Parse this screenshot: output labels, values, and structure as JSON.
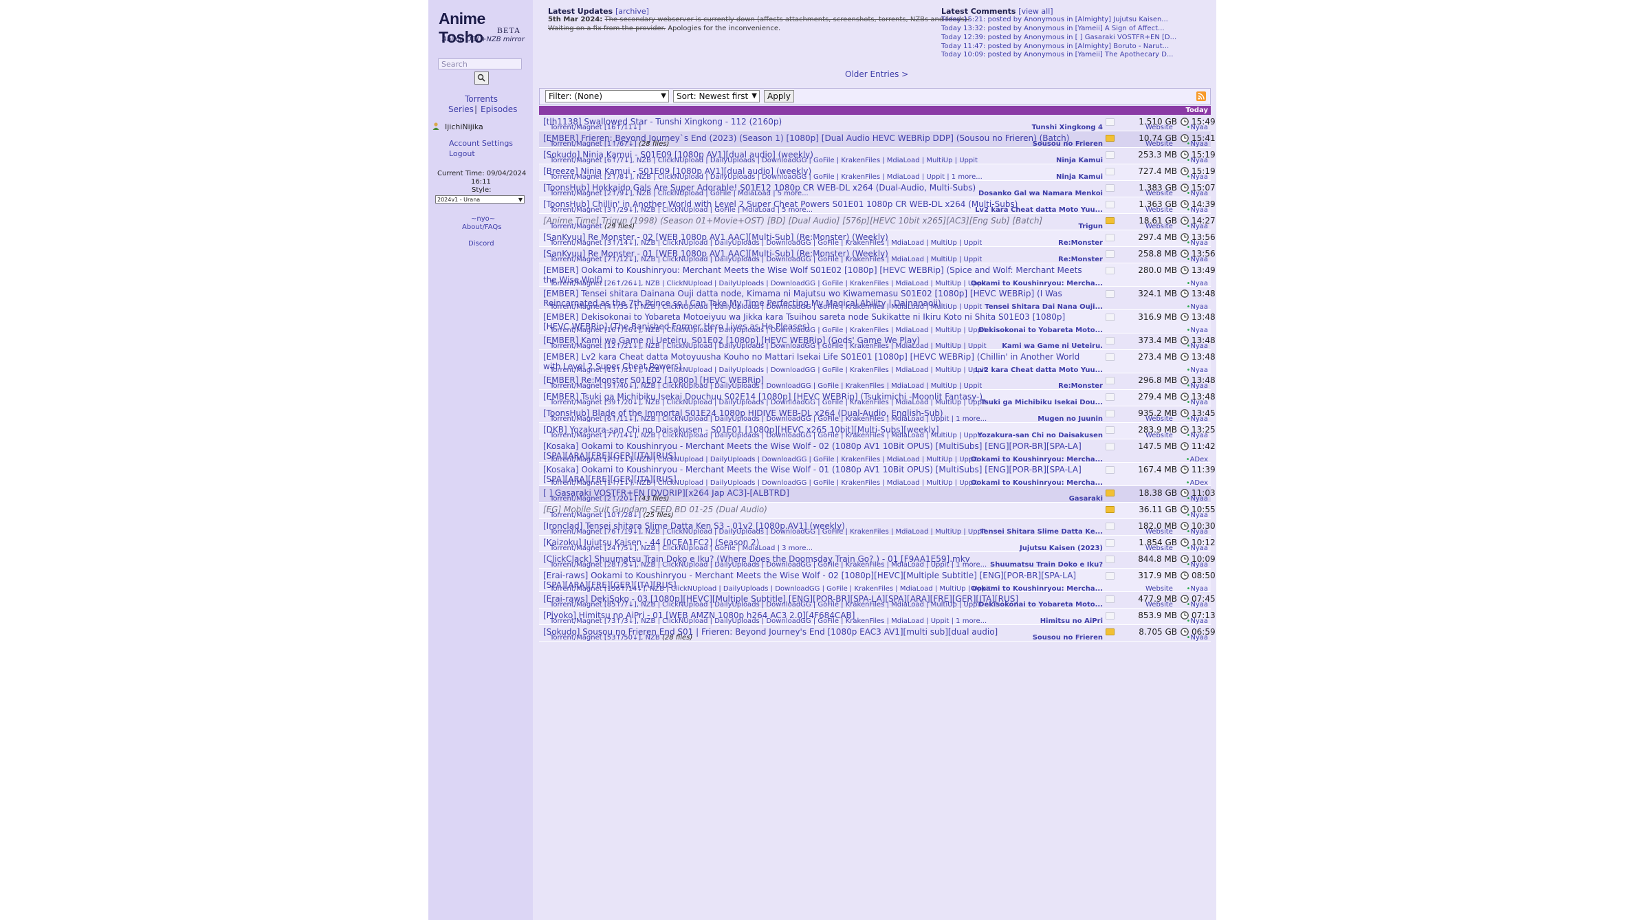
{
  "sidebar": {
    "logo_title": "Anime Tosho",
    "logo_beta": "BETA",
    "logo_sub": "Anime DDL+NZB mirror",
    "search_placeholder": "Search",
    "torrents": "Torrents",
    "series": "Series",
    "sep": "|",
    "episodes": "Episodes",
    "username": "IjichiNijika",
    "account_settings": "Account Settings",
    "logout": "Logout",
    "current_time_label": "Current Time: 09/04/2024",
    "current_time_value": "16:11",
    "style_label": "Style:",
    "style_value": "2024v1 - Urana",
    "nyo": "~nyo~",
    "about": "About/FAQs",
    "discord": "Discord"
  },
  "news": {
    "title": "Latest Updates",
    "archive": "[archive]",
    "date": "5th Mar 2024:",
    "struck_1": "The secondary webserver is currently down (affects attachments, screenshots, torrents, NZBs and feeds).",
    "struck_2": "Waiting on a fix from the provider.",
    "apology": " Apologies for the inconvenience."
  },
  "comments": {
    "title": "Latest Comments",
    "view_all": "[view all]",
    "items": [
      "Today 15:21: posted by Anonymous in [Almighty] Jujutsu Kaisen...",
      "Today 13:32: posted by Anonymous in [Yameii] A Sign of Affect...",
      "Today 12:39: posted by Anonymous in [ ] Gasaraki VOSTFR+EN [D...",
      "Today 11:47: posted by Anonymous in [Almighty] Boruto - Narut...",
      "Today 10:09: posted by Anonymous in [Yameii] The Apothecary D..."
    ]
  },
  "older_entries": "Older Entries >",
  "filter": {
    "filter_value": "Filter: (None)",
    "sort_value": "Sort: Newest first",
    "apply_label": "Apply",
    "day_label": "Today"
  },
  "colors": {
    "page_bg": "#e8e4f8",
    "sidebar_bg": "#dcd6f5",
    "link": "#3d3da8",
    "day_bar": "#8a3aa5",
    "uploader_green": "#2aa84a"
  },
  "rows": [
    {
      "title": "[tlh1138] Swallowed Star - Tunshi Xingkong - 112 (2160p)",
      "sub": "Torrent/Magnet [16↑/11↓]",
      "series": "Tunshi Xingkong 4",
      "website": "Website",
      "size": "1.510 GB",
      "time": "15:49",
      "uploader": "Nyaa",
      "batch": false,
      "grey": false
    },
    {
      "title": "[EMBER] Frieren: Beyond Journey`s End (2023) (Season 1) [1080p] [Dual Audio HEVC WEBRip DDP] (Sousou no Frieren) (Batch)",
      "sub": "Torrent/Magnet [1↑/67↓]",
      "files": "(28 files)",
      "series": "Sousou no Frieren",
      "website": "Website",
      "size": "10.74 GB",
      "time": "15:41",
      "uploader": "Nyaa",
      "batch": true,
      "grey": false
    },
    {
      "title": "[Sokudo] Ninja Kamui - S01E09 [1080p AV1][dual audio] (weekly)",
      "sub": "Torrent/Magnet [6↑/7↓], NZB | ClickNUpload | DailyUploads | DownloadGG | GoFile | KrakenFiles | MdiaLoad | MultiUp | Uppit",
      "series": "Ninja Kamui",
      "website": "",
      "size": "253.3 MB",
      "time": "15:19",
      "uploader": "Nyaa",
      "batch": false,
      "grey": false
    },
    {
      "title": "[Breeze] Ninja Kamui - S01E09 [1080p AV1][dual audio] (weekly)",
      "sub": "Torrent/Magnet [2↑/8↓], NZB | ClickNUpload | DailyUploads | DownloadGG | GoFile | KrakenFiles | MdiaLoad | Uppit | 1 more...",
      "series": "Ninja Kamui",
      "website": "",
      "size": "727.4 MB",
      "time": "15:19",
      "uploader": "Nyaa",
      "batch": false,
      "grey": false
    },
    {
      "title": "[ToonsHub] Hokkaido Gals Are Super Adorable! S01E12 1080p CR WEB-DL x264 (Dual-Audio, Multi-Subs)",
      "sub": "Torrent/Magnet [2↑/9↓], NZB | ClickNUpload | GoFile | MdiaLoad | 5 more...",
      "series": "Dosanko Gal wa Namara Menkoi",
      "website": "Website",
      "size": "1.383 GB",
      "time": "15:07",
      "uploader": "Nyaa",
      "batch": false,
      "grey": false
    },
    {
      "title": "[ToonsHub] Chillin' in Another World with Level 2 Super Cheat Powers S01E01 1080p CR WEB-DL x264 (Multi-Subs)",
      "sub": "Torrent/Magnet [3↑/29↓], NZB | ClickNUpload | GoFile | MdiaLoad | 5 more...",
      "series": "Lv2 kara Cheat datta Moto Yuu...",
      "website": "Website",
      "size": "1.363 GB",
      "time": "14:39",
      "uploader": "Nyaa",
      "batch": false,
      "grey": false
    },
    {
      "title": "[Anime Time] Trigun (1998) (Season 01+Movie+OST) [BD] [Dual Audio] [576p][HEVC 10bit x265][AC3][Eng Sub] [Batch]",
      "sub": "Torrent/Magnet",
      "files": "(29 files)",
      "series": "Trigun",
      "website": "Website",
      "size": "18.61 GB",
      "time": "14:27",
      "uploader": "Nyaa",
      "batch": false,
      "grey": true
    },
    {
      "title": "[SanKyuu] Re Monster - 02 [WEB 1080p AV1 AAC][Multi-Sub] (Re:Monster) (Weekly)",
      "sub": "Torrent/Magnet [3↑/14↓], NZB | ClickNUpload | DailyUploads | DownloadGG | GoFile | KrakenFiles | MdiaLoad | MultiUp | Uppit",
      "series": "Re:Monster",
      "website": "",
      "size": "297.4 MB",
      "time": "13:56",
      "uploader": "Nyaa",
      "batch": false,
      "grey": false
    },
    {
      "title": "[SanKyuu] Re Monster - 01 [WEB 1080p AV1 AAC][Multi-Sub] (Re:Monster) (Weekly)",
      "sub": "Torrent/Magnet [7↑/12↓], NZB | ClickNUpload | DailyUploads | DownloadGG | GoFile | KrakenFiles | MdiaLoad | MultiUp | Uppit",
      "series": "Re:Monster",
      "website": "",
      "size": "258.8 MB",
      "time": "13:56",
      "uploader": "Nyaa",
      "batch": false,
      "grey": false
    },
    {
      "title": "[EMBER] Ookami to Koushinryou: Merchant Meets the Wise Wolf S01E02 [1080p] [HEVC WEBRip] (Spice and Wolf: Merchant Meets the Wise Wolf)",
      "sub": "Torrent/Magnet [26↑/26↓], NZB | ClickNUpload | DailyUploads | DownloadGG | GoFile | KrakenFiles | MdiaLoad | MultiUp | Uppit",
      "series": "Ookami to Koushinryou: Mercha...",
      "website": "",
      "size": "280.0 MB",
      "time": "13:49",
      "uploader": "Nyaa",
      "batch": false,
      "grey": false,
      "two": true
    },
    {
      "title": "[EMBER] Tensei shitara Dainana Ouji datta node, Kimama ni Majutsu wo Kiwamemasu S01E02 [1080p] [HEVC WEBRip] (I Was Reincarnated as the 7th Prince so I Can Take My Time Perfecting My Magical Ability | Dainanaoji)",
      "sub": "Torrent/Magnet [4↑/35↓], NZB | ClickNUpload | DailyUploads | DownloadGG | GoFile | KrakenFiles | MdiaLoad | MultiUp | Uppit",
      "series": "Tensei Shitara Dai Nana Ouji...",
      "website": "",
      "size": "324.1 MB",
      "time": "13:48",
      "uploader": "Nyaa",
      "batch": false,
      "grey": false,
      "two": true
    },
    {
      "title": "[EMBER] Dekisokonai to Yobareta Motoeiyuu wa Jikka kara Tsuihou sareta node Sukikatte ni Ikiru Koto ni Shita S01E03 [1080p] [HEVC WEBRip] (The Banished Former Hero Lives as He Pleases)",
      "sub": "Torrent/Magnet [16↑/16↓], NZB | ClickNUpload | DailyUploads | DownloadGG | GoFile | KrakenFiles | MdiaLoad | MultiUp | Uppit",
      "series": "Dekisokonai to Yobareta Moto...",
      "website": "",
      "size": "316.9 MB",
      "time": "13:48",
      "uploader": "Nyaa",
      "batch": false,
      "grey": false,
      "two": true
    },
    {
      "title": "[EMBER] Kami wa Game ni Ueteiru. S01E02 [1080p] [HEVC WEBRip] (Gods' Game We Play)",
      "sub": "Torrent/Magnet [12↑/21↓], NZB | ClickNUpload | DailyUploads | DownloadGG | GoFile | KrakenFiles | MdiaLoad | MultiUp | Uppit",
      "series": "Kami wa Game ni Ueteiru.",
      "website": "",
      "size": "373.4 MB",
      "time": "13:48",
      "uploader": "Nyaa",
      "batch": false,
      "grey": false
    },
    {
      "title": "[EMBER] Lv2 kara Cheat datta Motoyuusha Kouho no Mattari Isekai Life S01E01 [1080p] [HEVC WEBRip] (Chillin' in Another World with Level 2 Super Cheat Powers)",
      "sub": "Torrent/Magnet [13↑/31↓], NZB | ClickNUpload | DailyUploads | DownloadGG | GoFile | KrakenFiles | MdiaLoad | MultiUp | Uppit",
      "series": "Lv2 kara Cheat datta Moto Yuu...",
      "website": "",
      "size": "273.4 MB",
      "time": "13:48",
      "uploader": "Nyaa",
      "batch": false,
      "grey": false,
      "two": true
    },
    {
      "title": "[EMBER] Re:Monster S01E02 [1080p] [HEVC WEBRip]",
      "sub": "Torrent/Magnet [9↑/40↓], NZB | ClickNUpload | DailyUploads | DownloadGG | GoFile | KrakenFiles | MdiaLoad | MultiUp | Uppit",
      "series": "Re:Monster",
      "website": "",
      "size": "296.8 MB",
      "time": "13:48",
      "uploader": "Nyaa",
      "batch": false,
      "grey": false
    },
    {
      "title": "[EMBER] Tsuki ga Michibiku Isekai Douchuu S02E14 [1080p] [HEVC WEBRip] (Tsukimichi -Moonlit Fantasy-)",
      "sub": "Torrent/Magnet [39↑/20↓], NZB | ClickNUpload | DailyUploads | DownloadGG | GoFile | KrakenFiles | MdiaLoad | MultiUp | Uppit",
      "series": "Tsuki ga Michibiku Isekai Dou...",
      "website": "",
      "size": "279.4 MB",
      "time": "13:48",
      "uploader": "Nyaa",
      "batch": false,
      "grey": false
    },
    {
      "title": "[ToonsHub] Blade of the Immortal S01E24 1080p HIDIVE WEB-DL x264 (Dual-Audio, English-Sub)",
      "sub": "Torrent/Magnet [6↑/11↓], NZB | ClickNUpload | DailyUploads | DownloadGG | GoFile | KrakenFiles | MdiaLoad | Uppit | 1 more...",
      "series": "Mugen no Juunin",
      "website": "Website",
      "size": "935.2 MB",
      "time": "13:45",
      "uploader": "Nyaa",
      "batch": false,
      "grey": false
    },
    {
      "title": "[DKB] Yozakura-san Chi no Daisakusen - S01E01 [1080p][HEVC x265 10bit][Multi-Subs][weekly]",
      "sub": "Torrent/Magnet [7↑/14↓], NZB | ClickNUpload | DailyUploads | DownloadGG | GoFile | KrakenFiles | MdiaLoad | MultiUp | Uppit",
      "series": "Yozakura-san Chi no Daisakusen",
      "website": "Website",
      "size": "283.9 MB",
      "time": "13:25",
      "uploader": "Nyaa",
      "batch": false,
      "grey": false
    },
    {
      "title": "[Kosaka] Ookami to Koushinryou - Merchant Meets the Wise Wolf - 02 (1080p AV1 10Bit OPUS) [MultiSubs] [ENG][POR-BR][SPA-LA][SPA][ARA][FRE][GER][ITA][RUS]",
      "sub": "Torrent/Magnet [2↑/1↓], NZB | ClickNUpload | DailyUploads | DownloadGG | GoFile | KrakenFiles | MdiaLoad | MultiUp | Uppit",
      "series": "Ookami to Koushinryou: Mercha...",
      "website": "",
      "size": "147.5 MB",
      "time": "11:42",
      "uploader": "ADex",
      "batch": false,
      "grey": false,
      "two": true
    },
    {
      "title": "[Kosaka] Ookami to Koushinryou - Merchant Meets the Wise Wolf - 01 (1080p AV1 10Bit OPUS) [MultiSubs] [ENG][POR-BR][SPA-LA][SPA][ARA][FRE][GER][ITA][RUS]",
      "sub": "Torrent/Magnet [1↑/1↓], NZB | ClickNUpload | DailyUploads | DownloadGG | GoFile | KrakenFiles | MdiaLoad | MultiUp | Uppit",
      "series": "Ookami to Koushinryou: Mercha...",
      "website": "",
      "size": "167.4 MB",
      "time": "11:39",
      "uploader": "ADex",
      "batch": false,
      "grey": false,
      "two": true
    },
    {
      "title": "[ ] Gasaraki VOSTFR+EN [DVDRIP][x264 Jap AC3]-[ALBTRD]",
      "sub": "Torrent/Magnet [2↑/20↓]",
      "files": "(43 files)",
      "series": "Gasaraki",
      "website": "",
      "size": "18.38 GB",
      "time": "11:03",
      "uploader": "Nyaa",
      "batch": true,
      "grey": false
    },
    {
      "title": "[EG] Mobile Suit Gundam SEED BD 01-25 (Dual Audio)",
      "sub": "Torrent/Magnet [10↑/28↓]",
      "files": "(25 files)",
      "series": "",
      "website": "",
      "size": "36.11 GB",
      "time": "10:55",
      "uploader": "Nyaa",
      "batch": false,
      "grey": true
    },
    {
      "title": "[Ironclad] Tensei shitara Slime Datta Ken S3 - 01v2 [1080p.AV1] (weekly)",
      "sub": "Torrent/Magnet [76↑/19↓], NZB | ClickNUpload | DailyUploads | DownloadGG | GoFile | KrakenFiles | MdiaLoad | MultiUp | Uppit",
      "series": "Tensei Shitara Slime Datta Ke...",
      "website": "Website",
      "size": "182.0 MB",
      "time": "10:30",
      "uploader": "Nyaa",
      "batch": false,
      "grey": false
    },
    {
      "title": "[Kaizoku] Jujutsu Kaisen - 44 [0CEA1FC2] (Season 2)",
      "sub": "Torrent/Magnet [24↑/5↓], NZB | ClickNUpload | GoFile | MdiaLoad | 3 more...",
      "series": "Jujutsu Kaisen (2023)",
      "website": "Website",
      "size": "1.854 GB",
      "time": "10:12",
      "uploader": "Nyaa",
      "batch": false,
      "grey": false
    },
    {
      "title": "[ClickClack] Shuumatsu Train Doko e Iku?  (Where Does the Doomsday Train Go? ) - 01 [F9AA1E59].mkv",
      "sub": "Torrent/Magnet [28↑/5↓], NZB | ClickNUpload | DailyUploads | DownloadGG | GoFile | KrakenFiles | MdiaLoad | Uppit | 1 more...",
      "series": "Shuumatsu Train Doko e Iku?",
      "website": "",
      "size": "844.8 MB",
      "time": "10:09",
      "uploader": "Nyaa",
      "batch": false,
      "grey": false
    },
    {
      "title": "[Erai-raws] Ookami to Koushinryou - Merchant Meets the Wise Wolf - 02 [1080p][HEVC][Multiple Subtitle] [ENG][POR-BR][SPA-LA][SPA][ARA][FRE][GER][ITA][RUS]",
      "sub": "Torrent/Magnet [156↑/14↓], NZB | ClickNUpload | DailyUploads | DownloadGG | GoFile | KrakenFiles | MdiaLoad | MultiUp | Uppit",
      "series": "Ookami to Koushinryou: Mercha...",
      "website": "Website",
      "size": "317.9 MB",
      "time": "08:50",
      "uploader": "Nyaa",
      "batch": false,
      "grey": false,
      "two": true
    },
    {
      "title": "[Erai-raws] DekiSoko - 03 [1080p][HEVC][Multiple Subtitle] [ENG][POR-BR][SPA-LA][SPA][ARA][FRE][GER][ITA][RUS]",
      "sub": "Torrent/Magnet [85↑/7↓], NZB | ClickNUpload | DailyUploads | DownloadGG | GoFile | KrakenFiles | MdiaLoad | MultiUp | Uppit",
      "series": "Dekisokonai to Yobareta Moto...",
      "website": "Website",
      "size": "477.9 MB",
      "time": "07:45",
      "uploader": "Nyaa",
      "batch": false,
      "grey": false
    },
    {
      "title": "[Piyoko] Himitsu no AiPri - 01 [WEB AMZN 1080p h264 AC3 2.0][4F684CAB]",
      "sub": "Torrent/Magnet [73↑/3↓], NZB | ClickNUpload | DailyUploads | DownloadGG | GoFile | KrakenFiles | MdiaLoad | Uppit | 1 more...",
      "series": "Himitsu no AiPri",
      "website": "",
      "size": "853.9 MB",
      "time": "07:13",
      "uploader": "Nyaa",
      "batch": false,
      "grey": false
    },
    {
      "title": "[Sokudo] Sousou no Frieren End S01 | Frieren: Beyond Journey's End [1080p EAC3 AV1][multi sub][dual audio]",
      "sub": "Torrent/Magnet [53↑/50↓], NZB",
      "files": "(28 files)",
      "series": "Sousou no Frieren",
      "website": "",
      "size": "8.705 GB",
      "time": "06:59",
      "uploader": "Nyaa",
      "batch": false,
      "grey": false
    }
  ]
}
